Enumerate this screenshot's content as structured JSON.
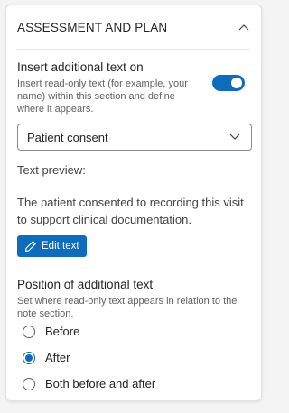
{
  "section": {
    "title": "ASSESSMENT AND PLAN"
  },
  "insert_text": {
    "label": "Insert additional text on",
    "description": "Insert read-only text (for example, your name) within this section and define where it appears.",
    "enabled": true
  },
  "dropdown": {
    "selected": "Patient consent"
  },
  "preview": {
    "label": "Text preview:",
    "text": "The patient consented to recording this visit to support clinical documentation."
  },
  "edit_button": {
    "label": "Edit text"
  },
  "position": {
    "label": "Position of additional text",
    "description": "Set where read-only text appears in relation to the note section.",
    "options": [
      {
        "label": "Before",
        "checked": false
      },
      {
        "label": "After",
        "checked": true
      },
      {
        "label": "Both before and after",
        "checked": false
      }
    ]
  },
  "colors": {
    "accent": "#0f6cbd",
    "text": "#242424",
    "muted": "#616161"
  },
  "icons": {
    "collapse": "chevron-up-icon",
    "dropdown": "chevron-down-icon",
    "edit": "pencil-icon"
  }
}
